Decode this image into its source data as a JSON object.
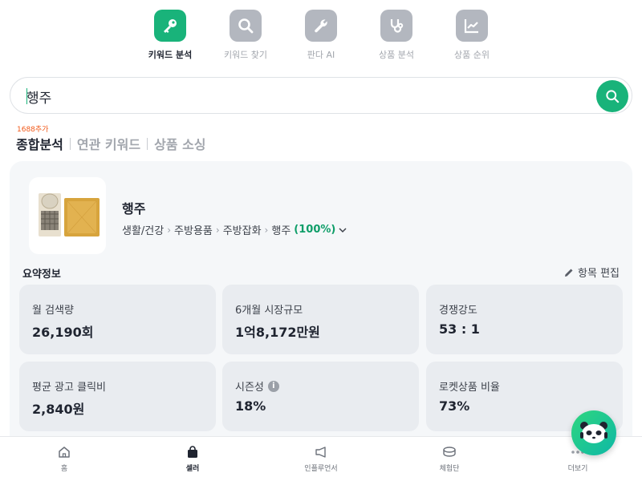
{
  "tools": [
    {
      "label": "키워드 분석",
      "icon": "key-icon",
      "active": true
    },
    {
      "label": "키워드 찾기",
      "icon": "search-icon",
      "active": false
    },
    {
      "label": "판다 AI",
      "icon": "wrench-icon",
      "active": false
    },
    {
      "label": "상품 분석",
      "icon": "stethoscope-icon",
      "active": false
    },
    {
      "label": "상품 순위",
      "icon": "chart-icon",
      "active": false
    }
  ],
  "search": {
    "value": "행주",
    "placeholder": ""
  },
  "tabs": {
    "badge": "1688추가",
    "items": [
      "종합분석",
      "연관 키워드",
      "상품 소싱"
    ],
    "active_index": 0
  },
  "product": {
    "title": "행주",
    "category": [
      "생활/건강",
      "주방용품",
      "주방잡화",
      "행주"
    ],
    "match_pct": "(100%)"
  },
  "summary": {
    "label": "요약정보",
    "edit_label": "항목 편집",
    "stats": [
      {
        "label": "월 검색량",
        "value": "26,190회",
        "info": false
      },
      {
        "label": "6개월 시장규모",
        "value": "1억8,172만원",
        "info": false
      },
      {
        "label": "경쟁강도",
        "value": "53 : 1",
        "info": false
      },
      {
        "label": "평균 광고 클릭비",
        "value": "2,840원",
        "info": false
      },
      {
        "label": "시즌성",
        "value": "18%",
        "info": true
      },
      {
        "label": "로켓상품 비율",
        "value": "73%",
        "info": false
      }
    ]
  },
  "bottom_nav": [
    {
      "label": "홈",
      "icon": "home-icon",
      "active": false
    },
    {
      "label": "셀러",
      "icon": "shopping-bag-icon",
      "active": true
    },
    {
      "label": "인플루언서",
      "icon": "megaphone-icon",
      "active": false
    },
    {
      "label": "체험단",
      "icon": "coins-icon",
      "active": false
    },
    {
      "label": "더보기",
      "icon": "more-icon",
      "active": false
    }
  ],
  "colors": {
    "accent": "#19b37a",
    "pct": "#0f9e69",
    "badge": "#f25a1a"
  }
}
